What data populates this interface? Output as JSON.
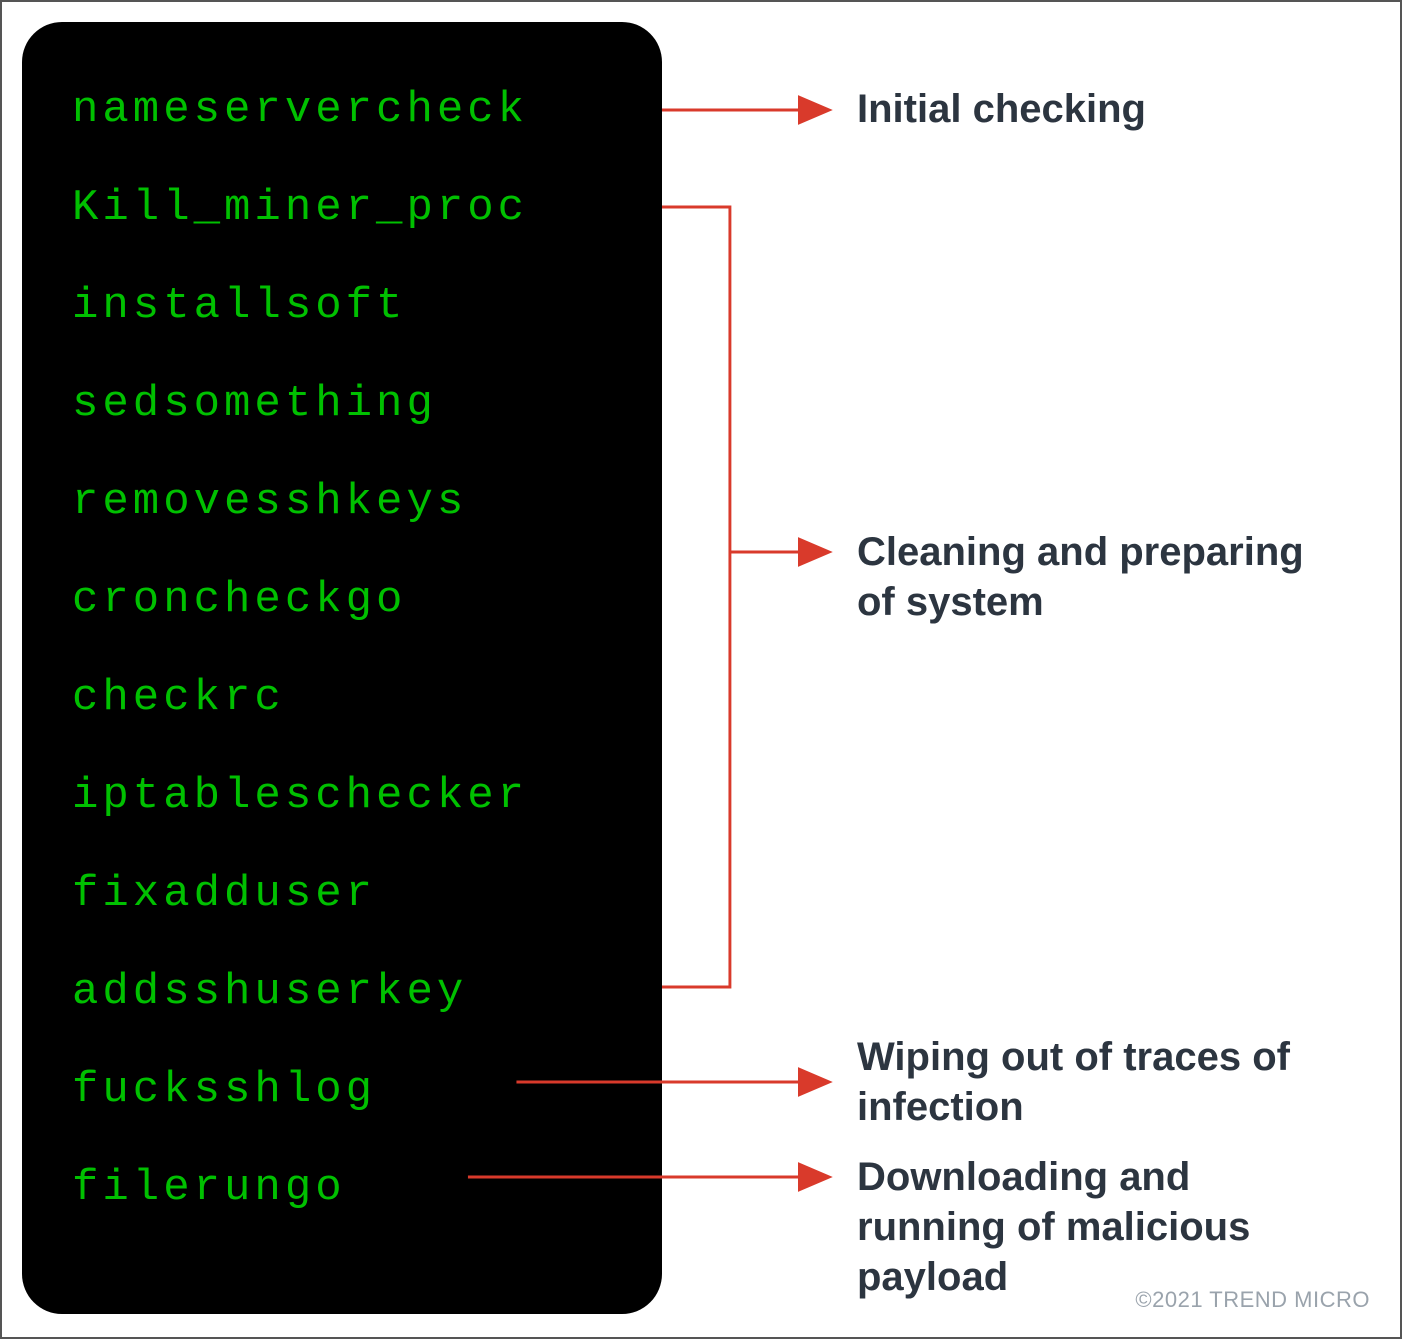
{
  "terminal": {
    "lines": [
      "nameservercheck",
      "Kill_miner_proc",
      "installsoft",
      "sedsomething",
      "removesshkeys",
      "croncheckgo",
      "checkrc",
      "iptableschecker",
      "fixadduser",
      "addsshuserkey",
      "fucksshlog",
      "filerungo"
    ]
  },
  "annotations": {
    "initial": "Initial checking",
    "cleaning": "Cleaning and preparing of system",
    "wiping": "Wiping out of traces of infection",
    "downloading": "Downloading and running of malicious payload"
  },
  "footer": {
    "copyright": "©2021 TREND MICRO"
  },
  "diagram": {
    "groups": [
      {
        "label_key": "initial",
        "function_indices": [
          0
        ]
      },
      {
        "label_key": "cleaning",
        "function_indices": [
          1,
          2,
          3,
          4,
          5,
          6,
          7,
          8,
          9
        ]
      },
      {
        "label_key": "wiping",
        "function_indices": [
          10
        ]
      },
      {
        "label_key": "downloading",
        "function_indices": [
          11
        ]
      }
    ],
    "colors": {
      "terminal_bg": "#000000",
      "terminal_text": "#00c000",
      "arrow": "#d93a2b",
      "annotation_text": "#2c3540"
    }
  }
}
